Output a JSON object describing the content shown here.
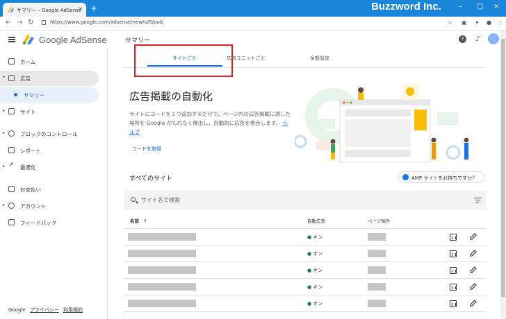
{
  "browser": {
    "tab_title": "サマリー – Google AdSense",
    "new_tab": "+",
    "tab_close": "×",
    "brand_label": "Buzzword Inc.",
    "url": "https://www.google.com/adsense/new/u/0/pub",
    "window_controls": [
      "–",
      "□",
      "×"
    ]
  },
  "header": {
    "logo_text": "Google AdSense",
    "page_title": "サマリー"
  },
  "sidebar": {
    "items": [
      {
        "label": "ホーム",
        "icon": "home-icon"
      },
      {
        "label": "広告",
        "icon": "ads-icon",
        "expanded": true
      },
      {
        "label": "サマリー",
        "icon": "dot-icon",
        "selected": true
      },
      {
        "label": "サイト",
        "icon": "sites-icon"
      },
      {
        "label": "ブロックのコントロール",
        "icon": "block-icon"
      },
      {
        "label": "レポート",
        "icon": "report-icon"
      },
      {
        "label": "最適化",
        "icon": "trend-icon"
      },
      {
        "label": "お支払い",
        "icon": "payments-icon"
      },
      {
        "label": "アカウント",
        "icon": "gear-icon"
      },
      {
        "label": "フィードバック",
        "icon": "feedback-icon"
      }
    ],
    "footer": {
      "brand": "Google",
      "privacy": "プライバシー",
      "terms": "利用規約"
    }
  },
  "tabs": [
    {
      "label": "サイトごと",
      "active": true
    },
    {
      "label": "広告ユニットごと",
      "active": false
    },
    {
      "label": "全般設定",
      "active": false
    }
  ],
  "hero": {
    "title": "広告掲載の自動化",
    "description": "サイトにコードを１つ追加するだけで、ページ内の広告掲載に適した場所を Google がもれなく検出し、自動的に広告を表示します。",
    "help": "ヘルプ",
    "get_code": "コードを取得"
  },
  "sites": {
    "heading": "すべてのサイト",
    "amp_button": "AMP サイトをお持ちですか？",
    "search_placeholder": "サイト名で検索",
    "columns": {
      "name": "名前",
      "sort": "↑",
      "auto_ads": "自動広告",
      "page_exclusion": "ページ除外"
    },
    "rows": [
      {
        "status": "オン"
      },
      {
        "status": "オン"
      },
      {
        "status": "オン"
      },
      {
        "status": "オン"
      },
      {
        "status": "オン"
      }
    ]
  },
  "colors": {
    "accent": "#1967d2",
    "highlight": "#e0202a",
    "chrome": "#1a86d9",
    "status_on": "#188038"
  }
}
